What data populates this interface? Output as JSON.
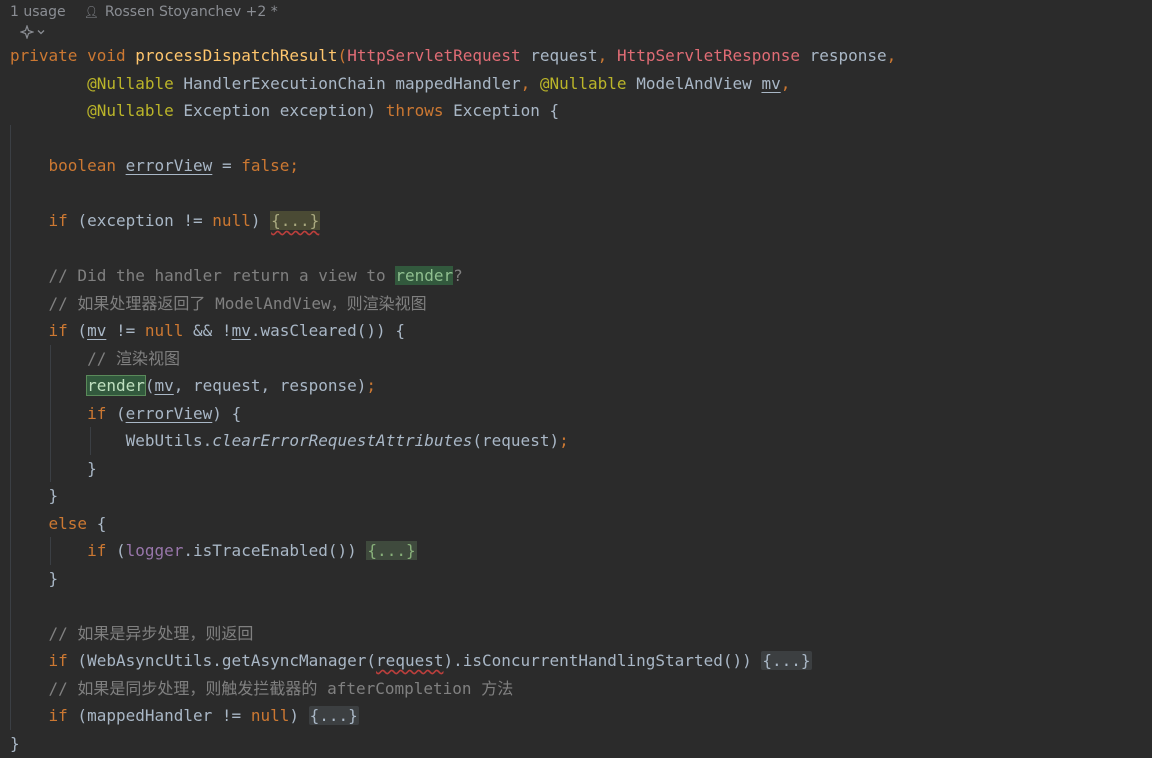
{
  "inlay": {
    "usages": "1 usage",
    "authors": "Rossen Stoyanchev +2 *"
  },
  "icons": {
    "person": "person-icon",
    "ai": "ai-assistant-icon",
    "chevron": "chevron-down-icon"
  },
  "colors": {
    "background": "#2b2b2b",
    "keyword": "#cc7832",
    "method": "#ffc66d",
    "comment": "#808080",
    "field": "#9876aa",
    "annotation": "#bbb529",
    "error_type": "#e06c75",
    "plain": "#a9b7c6"
  },
  "code": {
    "l1": {
      "kw1": "private",
      "kw2": "void",
      "name": "processDispatchResult",
      "t1": "HttpServletRequest",
      "p1": "request",
      "t2": "HttpServletResponse",
      "p2": "response"
    },
    "l2": {
      "ann1": "@Nullable",
      "t1": "HandlerExecutionChain",
      "p1": "mappedHandler",
      "ann2": "@Nullable",
      "t2": "ModelAndView",
      "p2": "mv"
    },
    "l3": {
      "ann1": "@Nullable",
      "t1": "Exception",
      "p1": "exception",
      "kw": "throws",
      "t2": "Exception",
      "brace": "{"
    },
    "l5": {
      "type": "boolean",
      "var": "errorView",
      "op": "=",
      "val": "false"
    },
    "l7": {
      "kw": "if",
      "cond": "(exception != ",
      "nul": "null",
      "close": ")",
      "fold": "{...}"
    },
    "l9": {
      "comment": "// Did the handler return a view to ",
      "hl": "render",
      "q": "?"
    },
    "l10": {
      "comment": "// 如果处理器返回了 ModelAndView，则渲染视图"
    },
    "l11": {
      "kw": "if",
      "a": " (",
      "mv1": "mv",
      "b": " != ",
      "nul": "null",
      "c": " && !",
      "mv2": "mv",
      "d": ".wasCleared()) {"
    },
    "l12": {
      "comment": "// 渲染视图"
    },
    "l13": {
      "call": "render",
      "a": "(",
      "mv": "mv",
      "b": ", request, response)"
    },
    "l14": {
      "kw": "if",
      "a": " (",
      "var": "errorView",
      "b": ") {"
    },
    "l15": {
      "cls": "WebUtils",
      "dot": ".",
      "method": "clearErrorRequestAttributes",
      "args": "(request)"
    },
    "l16": {
      "brace": "}"
    },
    "l17": {
      "brace": "}"
    },
    "l18": {
      "kw": "else",
      "brace": " {"
    },
    "l19": {
      "kw": "if",
      "a": " (",
      "field": "logger",
      "b": ".isTraceEnabled()) ",
      "fold": "{...}"
    },
    "l20": {
      "brace": "}"
    },
    "l22": {
      "comment": "// 如果是异步处理，则返回"
    },
    "l23": {
      "kw": "if",
      "a": " (WebAsyncUtils.getAsyncManager(",
      "arg": "request",
      "b": ").isConcurrentHandlingStarted()) ",
      "fold": "{...}"
    },
    "l24": {
      "comment": "// 如果是同步处理，则触发拦截器的 afterCompletion 方法"
    },
    "l25": {
      "kw": "if",
      "a": " (mappedHandler != ",
      "nul": "null",
      "b": ") ",
      "fold": "{...}"
    },
    "l26": {
      "brace": "}"
    },
    "punct": {
      "open": "(",
      "comma": ",",
      "semi": ";"
    }
  }
}
